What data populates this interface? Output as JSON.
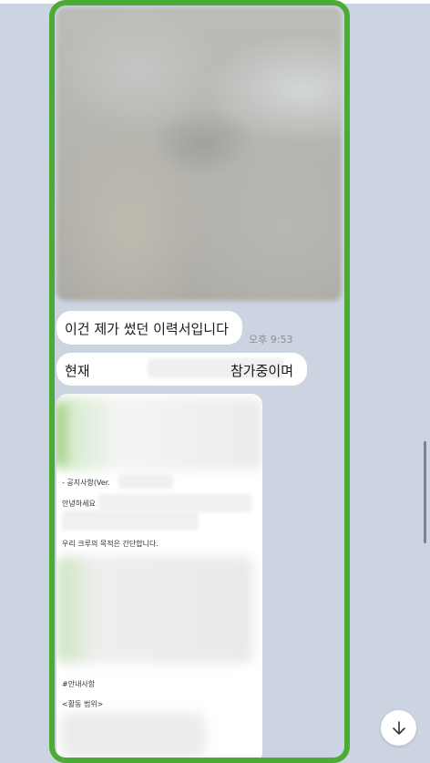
{
  "chat": {
    "messages": [
      {
        "text": "이건 제가 썼던 이력서입니다",
        "time": "오후 9:53"
      },
      {
        "text_before": "현재",
        "text_after": "참가중이며"
      }
    ],
    "document": {
      "line1": "- 공지사항(Ver.",
      "line2": "안녕하세요",
      "line3": "우리 크루의 목적은 간단합니다.",
      "line4": "#안내사항",
      "line5": "<활동 범위>"
    }
  },
  "scroll_down_icon": "arrow-down-icon",
  "colors": {
    "background": "#ccd3e1",
    "highlight": "#4cab34",
    "bubble": "#ffffff"
  }
}
